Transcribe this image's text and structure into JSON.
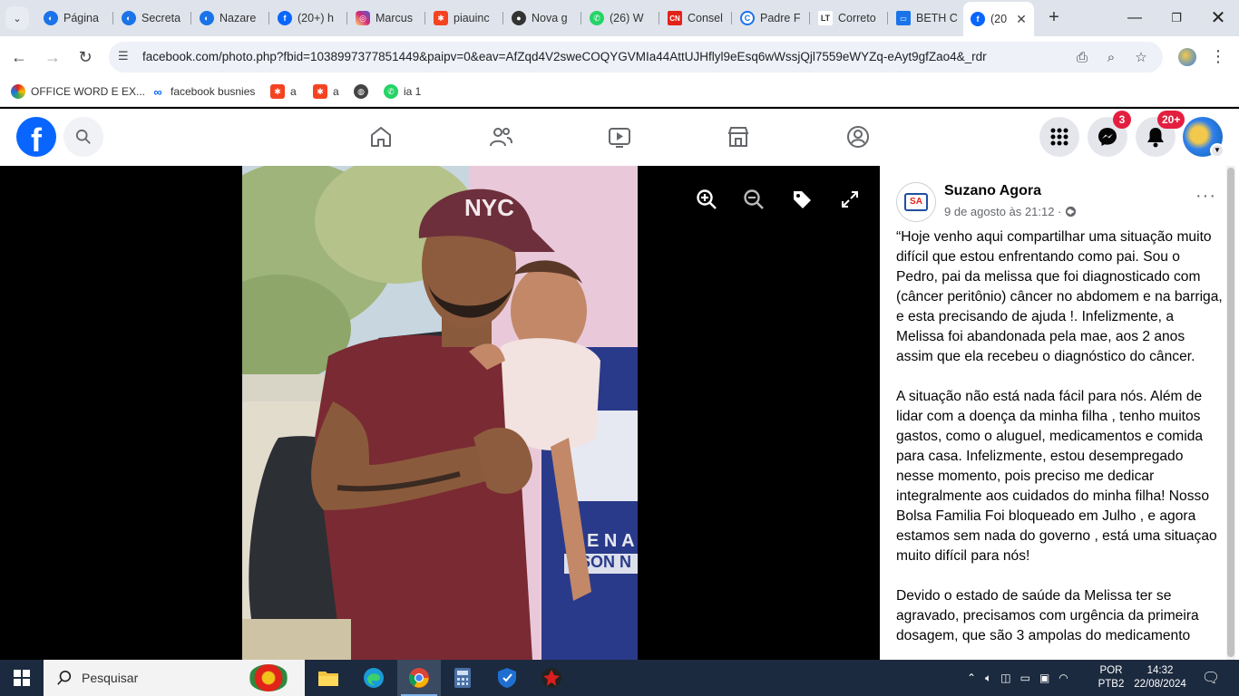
{
  "tabs": [
    {
      "label": "Página",
      "icon": "edge-globe-icon",
      "color": "#1a73e8"
    },
    {
      "label": "Secreta",
      "icon": "edge-globe-icon",
      "color": "#1a73e8"
    },
    {
      "label": "Nazare",
      "icon": "edge-globe-icon",
      "color": "#1a73e8"
    },
    {
      "label": "(20+) h",
      "icon": "facebook-icon",
      "color": "#0866ff"
    },
    {
      "label": "Marcus",
      "icon": "instagram-icon",
      "color": "#d62976"
    },
    {
      "label": "piauinc",
      "icon": "joomla-icon",
      "color": "#f44321"
    },
    {
      "label": "Nova g",
      "icon": "github-icon",
      "color": "#333333"
    },
    {
      "label": "(26) W",
      "icon": "whatsapp-icon",
      "color": "#25d366"
    },
    {
      "label": "Consel",
      "icon": "cn-icon",
      "color": "#e2231a"
    },
    {
      "label": "Padre F",
      "icon": "c-logo-icon",
      "color": "#1a73e8"
    },
    {
      "label": "Correto",
      "icon": "lt-icon",
      "color": "#333333"
    },
    {
      "label": "BETH C",
      "icon": "card-icon",
      "color": "#1a73e8"
    },
    {
      "label": "(20",
      "icon": "facebook-icon",
      "color": "#0866ff"
    }
  ],
  "address": {
    "url": "facebook.com/photo.php?fbid=1038997377851449&paipv=0&eav=AfZqd4V2sweCOQYGVMIa44AttUJHflyl9eEsq6wWssjQjl7559eWYZq-eAyt9gfZao4&_rdr"
  },
  "bookmarks": [
    {
      "label": "OFFICE WORD E EX...",
      "icon": "office-icon"
    },
    {
      "label": "facebook busnies",
      "icon": "meta-icon"
    },
    {
      "label": "a",
      "icon": "joomla-icon"
    },
    {
      "label": "a",
      "icon": "joomla-icon"
    },
    {
      "label": "",
      "icon": "globe-icon"
    },
    {
      "label": "ia 1",
      "icon": "whatsapp-icon"
    }
  ],
  "fb": {
    "messenger_badge": "3",
    "notifications_badge": "20+",
    "brand_color": "#0866ff"
  },
  "post": {
    "page_name": "Suzano Agora",
    "page_initials": "SA",
    "timestamp": "9 de agosto às 21:12 ·",
    "paragraphs": [
      "“Hoje venho aqui compartilhar uma situação muito difícil que estou enfrentando como pai. Sou o Pedro, pai da melissa que foi diagnosticado com (câncer peritônio) câncer no abdomem e na barriga, e esta precisando de ajuda !. Infelizmente, a Melissa foi abandonada pela mae, aos 2 anos assim que ela recebeu o diagnóstico do câncer.",
      "A situação não está nada fácil para nós. Além de lidar com a doença da minha filha , tenho muitos gastos, como o aluguel, medicamentos e comida para casa. Infelizmente, estou desempregado nesse momento, pois preciso me dedicar integralmente aos cuidados do minha filha! Nosso Bolsa Familia Foi bloqueado em Julho , e agora estamos sem nada do governo , está uma situaçao muito difícil para nós!",
      "Devido o estado de saúde da Melissa ter se agravado, precisamos com urgência da primeira dosagem, que são 3 ampolas do medicamento"
    ]
  },
  "photo": {
    "cap_text": "NYC",
    "banner_text_1": "R E N A",
    "banner_text_2": "SON N"
  },
  "taskbar": {
    "search_placeholder": "Pesquisar",
    "language_1": "POR",
    "language_2": "PTB2",
    "time": "14:32",
    "date": "22/08/2024"
  }
}
